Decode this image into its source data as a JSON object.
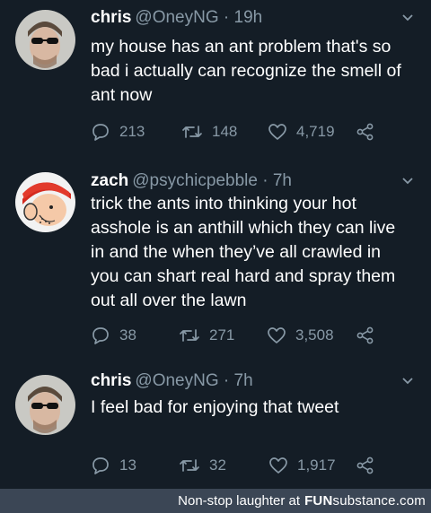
{
  "tweets": [
    {
      "name": "chris",
      "handle": "@OneyNG",
      "time": "19h",
      "lines": [
        "my house has an ant problem that's so",
        "bad i actually can recognize the smell of",
        "ant now"
      ],
      "replies": "213",
      "retweets": "148",
      "likes": "4,719"
    },
    {
      "name": "zach",
      "handle": "@psychicpebble",
      "time": "7h",
      "lines": [
        "trick the ants into thinking your hot",
        "asshole is an anthill which they can live",
        "in and the when they’ve all crawled in",
        "you can shart real hard and spray them",
        "out all over the lawn"
      ],
      "replies": "38",
      "retweets": "271",
      "likes": "3,508"
    },
    {
      "name": "chris",
      "handle": "@OneyNG",
      "time": "7h",
      "lines": [
        "I feel bad for enjoying that tweet"
      ],
      "replies": "13",
      "retweets": "32",
      "likes": "1,917"
    }
  ],
  "footer": {
    "text": "Non-stop laughter at",
    "brand_fun": "FUN",
    "brand_sub": "substance",
    "brand_com": ".com"
  },
  "icons": {
    "reply": "reply-icon",
    "retweet": "retweet-icon",
    "like": "heart-icon",
    "share": "share-icon",
    "menu": "chevron-down-icon"
  },
  "colors": {
    "background": "#141d26",
    "secondary_text": "#8899a6",
    "footer_bg": "#3b4655"
  }
}
